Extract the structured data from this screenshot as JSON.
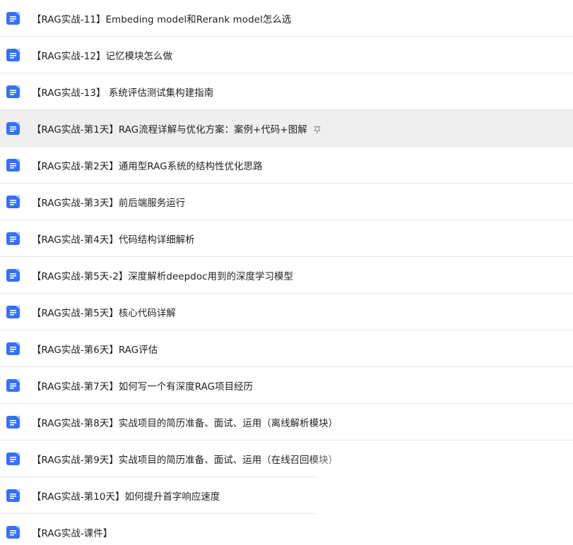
{
  "documents": [
    {
      "title": "【RAG实战-11】Embeding model和Rerank model怎么选",
      "icon": "doc-icon"
    },
    {
      "title": "【RAG实战-12】记忆模块怎么做",
      "icon": "doc-icon"
    },
    {
      "title": "【RAG实战-13】 系统评估测试集构建指南",
      "icon": "doc-icon"
    },
    {
      "title": "【RAG实战-第1天】RAG流程详解与优化方案：案例+代码+图解",
      "icon": "doc-icon",
      "pinned": true,
      "pin_icon": "pin-icon",
      "selected": true
    },
    {
      "title": "【RAG实战-第2天】通用型RAG系统的结构性优化思路",
      "icon": "doc-icon"
    },
    {
      "title": "【RAG实战-第3天】前后端服务运行",
      "icon": "doc-icon"
    },
    {
      "title": "【RAG实战-第4天】代码结构详细解析",
      "icon": "doc-icon"
    },
    {
      "title": "【RAG实战-第5天-2】深度解析deepdoc用到的深度学习模型",
      "icon": "doc-icon"
    },
    {
      "title": "【RAG实战-第5天】核心代码详解",
      "icon": "doc-icon"
    },
    {
      "title": "【RAG实战-第6天】RAG评估",
      "icon": "doc-icon"
    },
    {
      "title": "【RAG实战-第7天】如何写一个有深度RAG项目经历",
      "icon": "doc-icon"
    },
    {
      "title": "【RAG实战-第8天】实战项目的简历准备、面试、运用（离线解析模块）",
      "icon": "doc-icon"
    },
    {
      "title": "【RAG实战-第9天】实战项目的简历准备、面试、运用（在线召回模块）",
      "icon": "doc-icon"
    },
    {
      "title": "【RAG实战-第10天】如何提升首字响应速度",
      "icon": "doc-icon"
    },
    {
      "title": "【RAG实战-课件】",
      "icon": "doc-icon"
    }
  ],
  "colors": {
    "doc_icon_blue": "#3370ff",
    "selected_row_bg": "#efefef",
    "divider": "#e6e6e6",
    "text": "#1f1f1f",
    "pin_icon": "#8f959e"
  }
}
